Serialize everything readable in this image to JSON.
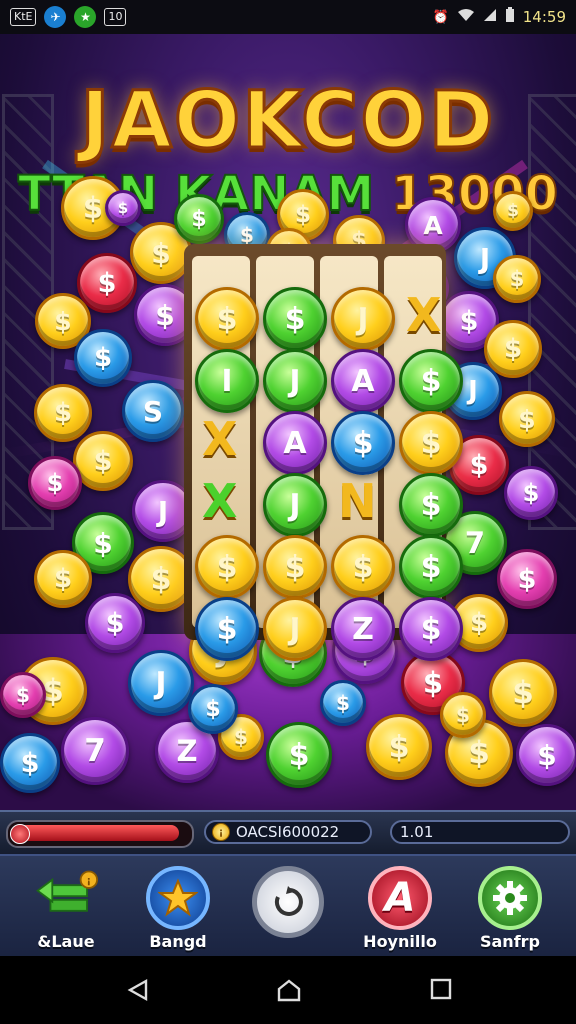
{
  "status_bar": {
    "badge_text": "KtE",
    "level_text": "10",
    "time": "14:59"
  },
  "title": {
    "main": "JAOKCOD",
    "sub_green": "TTAN KANAM",
    "sub_gold": "13000"
  },
  "reels": {
    "symbols": [
      [
        "$",
        "I",
        "X",
        "X",
        "$",
        "$"
      ],
      [
        "$",
        "J",
        "A",
        "J",
        "$",
        "J"
      ],
      [
        "J",
        "A",
        "$",
        "N",
        "$",
        "Z"
      ],
      [
        "X",
        "$",
        "$",
        "$",
        "$",
        "$"
      ]
    ]
  },
  "hud": {
    "progress": 0.97,
    "balance": "OACSI600022",
    "bet": "1.01"
  },
  "bottom_nav": [
    {
      "label": "&Laue",
      "icon": "arrow-left-icon",
      "color": "#33a52a"
    },
    {
      "label": "Bangd",
      "icon": "star-icon",
      "color": "#1d5fbf"
    },
    {
      "label": "",
      "icon": "spin-icon",
      "color": "#d9dde6"
    },
    {
      "label": "Hoynillo",
      "icon": "letter-a-icon",
      "color": "#d3172c"
    },
    {
      "label": "Sanfrp",
      "icon": "gear-icon",
      "color": "#2e9a2a"
    }
  ],
  "colors": {
    "accent_gold": "#ffd23a",
    "title_green": "#57e03a",
    "bar_bg": "#2d3a5c"
  }
}
